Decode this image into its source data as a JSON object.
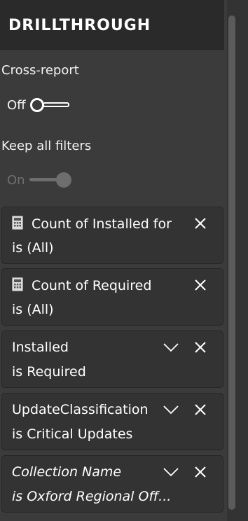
{
  "header": {
    "title": "DRILLTHROUGH"
  },
  "cross_report": {
    "label": "Cross-report",
    "state": "Off"
  },
  "keep_all_filters": {
    "label": "Keep all filters",
    "state": "On"
  },
  "filters": [
    {
      "title": "Count of Installed for",
      "subtitle": "is (All)",
      "icon": "calculator-icon",
      "has_chevron": false,
      "italic": false
    },
    {
      "title": "Count of Required",
      "subtitle": "is (All)",
      "icon": "calculator-icon",
      "has_chevron": false,
      "italic": false
    },
    {
      "title": "Installed",
      "subtitle": "is Required",
      "icon": null,
      "has_chevron": true,
      "italic": false
    },
    {
      "title": "UpdateClassification",
      "subtitle": "is Critical Updates",
      "icon": null,
      "has_chevron": true,
      "italic": false
    },
    {
      "title": "Collection Name",
      "subtitle": "is Oxford Regional Off...",
      "icon": null,
      "has_chevron": true,
      "italic": true
    }
  ],
  "colors": {
    "pane_bg": "#3b3b3b",
    "header_bg": "#2a2a2a",
    "card_bg": "#333333",
    "text": "#ffffff",
    "disabled": "#6e6e6e"
  }
}
